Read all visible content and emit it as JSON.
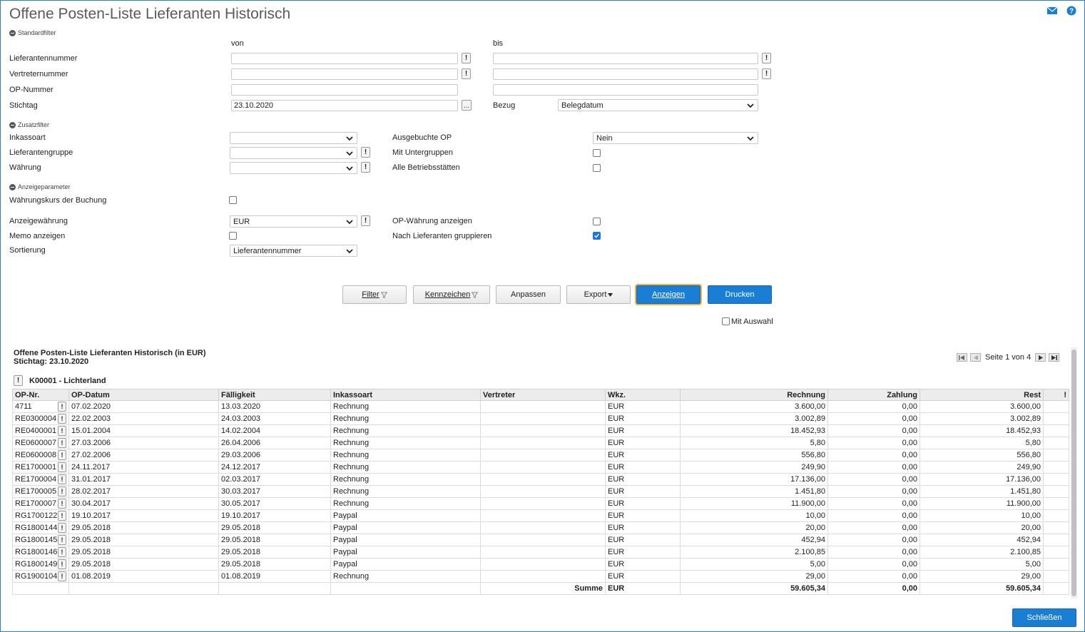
{
  "title": "Offene Posten-Liste Lieferanten Historisch",
  "icons": {
    "mail": "mail-icon",
    "help": "help-icon"
  },
  "sections": {
    "standard": "Standardfilter",
    "zusatz": "Zusatzfilter",
    "anzeige": "Anzeigeparameter"
  },
  "standard": {
    "von": "von",
    "bis": "bis",
    "lieferantennummer": "Lieferantennummer",
    "vertreternummer": "Vertreternummer",
    "opnummer": "OP-Nummer",
    "stichtag_label": "Stichtag",
    "stichtag_value": "23.10.2020",
    "bezug_label": "Bezug",
    "bezug_value": "Belegdatum"
  },
  "zusatz": {
    "inkassoart": "Inkassoart",
    "lieferantengruppe": "Lieferantengruppe",
    "waehrung": "Währung",
    "ausgebuchte_op": "Ausgebuchte OP",
    "ausgebuchte_op_value": "Nein",
    "mit_untergruppen": "Mit Untergruppen",
    "alle_betriebsstaetten": "Alle Betriebsstätten"
  },
  "anzeige": {
    "waehrungskurs": "Währungskurs der Buchung",
    "anzeigewaehrung": "Anzeigewährung",
    "anzeigewaehrung_value": "EUR",
    "memo": "Memo anzeigen",
    "sortierung": "Sortierung",
    "sortierung_value": "Lieferantennummer",
    "op_waehrung": "OP-Währung anzeigen",
    "nach_lieferanten": "Nach Lieferanten gruppieren"
  },
  "buttons": {
    "filter": "Filter",
    "kennzeichen": "Kennzeichen",
    "anpassen": "Anpassen",
    "export": "Export",
    "anzeigen": "Anzeigen",
    "drucken": "Drucken",
    "mit_auswahl": "Mit Auswahl",
    "schliessen": "Schließen"
  },
  "report": {
    "title": "Offene Posten-Liste Lieferanten Historisch (in EUR)",
    "stichtag": "Stichtag: 23.10.2020",
    "group": "K00001 - Lichterland",
    "pager": "Seite 1 von 4",
    "columns": [
      "OP-Nr.",
      "OP-Datum",
      "Fälligkeit",
      "Inkassoart",
      "Vertreter",
      "Wkz.",
      "Rechnung",
      "Zahlung",
      "Rest",
      "!"
    ],
    "rows": [
      [
        "4711",
        "07.02.2020",
        "13.03.2020",
        "Rechnung",
        "",
        "EUR",
        "3.600,00",
        "0,00",
        "3.600,00"
      ],
      [
        "RE0300004",
        "22.02.2003",
        "24.03.2003",
        "Rechnung",
        "",
        "EUR",
        "3.002,89",
        "0,00",
        "3.002,89"
      ],
      [
        "RE0400001",
        "15.01.2004",
        "14.02.2004",
        "Rechnung",
        "",
        "EUR",
        "18.452,93",
        "0,00",
        "18.452,93"
      ],
      [
        "RE0600007",
        "27.03.2006",
        "26.04.2006",
        "Rechnung",
        "",
        "EUR",
        "5,80",
        "0,00",
        "5,80"
      ],
      [
        "RE0600008",
        "27.02.2006",
        "29.03.2006",
        "Rechnung",
        "",
        "EUR",
        "556,80",
        "0,00",
        "556,80"
      ],
      [
        "RE1700001",
        "24.11.2017",
        "24.12.2017",
        "Rechnung",
        "",
        "EUR",
        "249,90",
        "0,00",
        "249,90"
      ],
      [
        "RE1700004",
        "31.01.2017",
        "02.03.2017",
        "Rechnung",
        "",
        "EUR",
        "17.136,00",
        "0,00",
        "17.136,00"
      ],
      [
        "RE1700005",
        "28.02.2017",
        "30.03.2017",
        "Rechnung",
        "",
        "EUR",
        "1.451,80",
        "0,00",
        "1.451,80"
      ],
      [
        "RE1700007",
        "30.04.2017",
        "30.05.2017",
        "Rechnung",
        "",
        "EUR",
        "11.900,00",
        "0,00",
        "11.900,00"
      ],
      [
        "RG1700122",
        "19.10.2017",
        "19.10.2017",
        "Paypal",
        "",
        "EUR",
        "10,00",
        "0,00",
        "10,00"
      ],
      [
        "RG1800144",
        "29.05.2018",
        "29.05.2018",
        "Paypal",
        "",
        "EUR",
        "20,00",
        "0,00",
        "20,00"
      ],
      [
        "RG1800145",
        "29.05.2018",
        "29.05.2018",
        "Paypal",
        "",
        "EUR",
        "452,94",
        "0,00",
        "452,94"
      ],
      [
        "RG1800146",
        "29.05.2018",
        "29.05.2018",
        "Paypal",
        "",
        "EUR",
        "2.100,85",
        "0,00",
        "2.100,85"
      ],
      [
        "RG1800149",
        "29.05.2018",
        "29.05.2018",
        "Paypal",
        "",
        "EUR",
        "5,00",
        "0,00",
        "5,00"
      ],
      [
        "RG1900104",
        "01.08.2019",
        "01.08.2019",
        "Rechnung",
        "",
        "EUR",
        "29,00",
        "0,00",
        "29,00"
      ]
    ],
    "sum": {
      "label": "Summe",
      "wkz": "EUR",
      "rechnung": "59.605,34",
      "zahlung": "0,00",
      "rest": "59.605,34"
    }
  }
}
